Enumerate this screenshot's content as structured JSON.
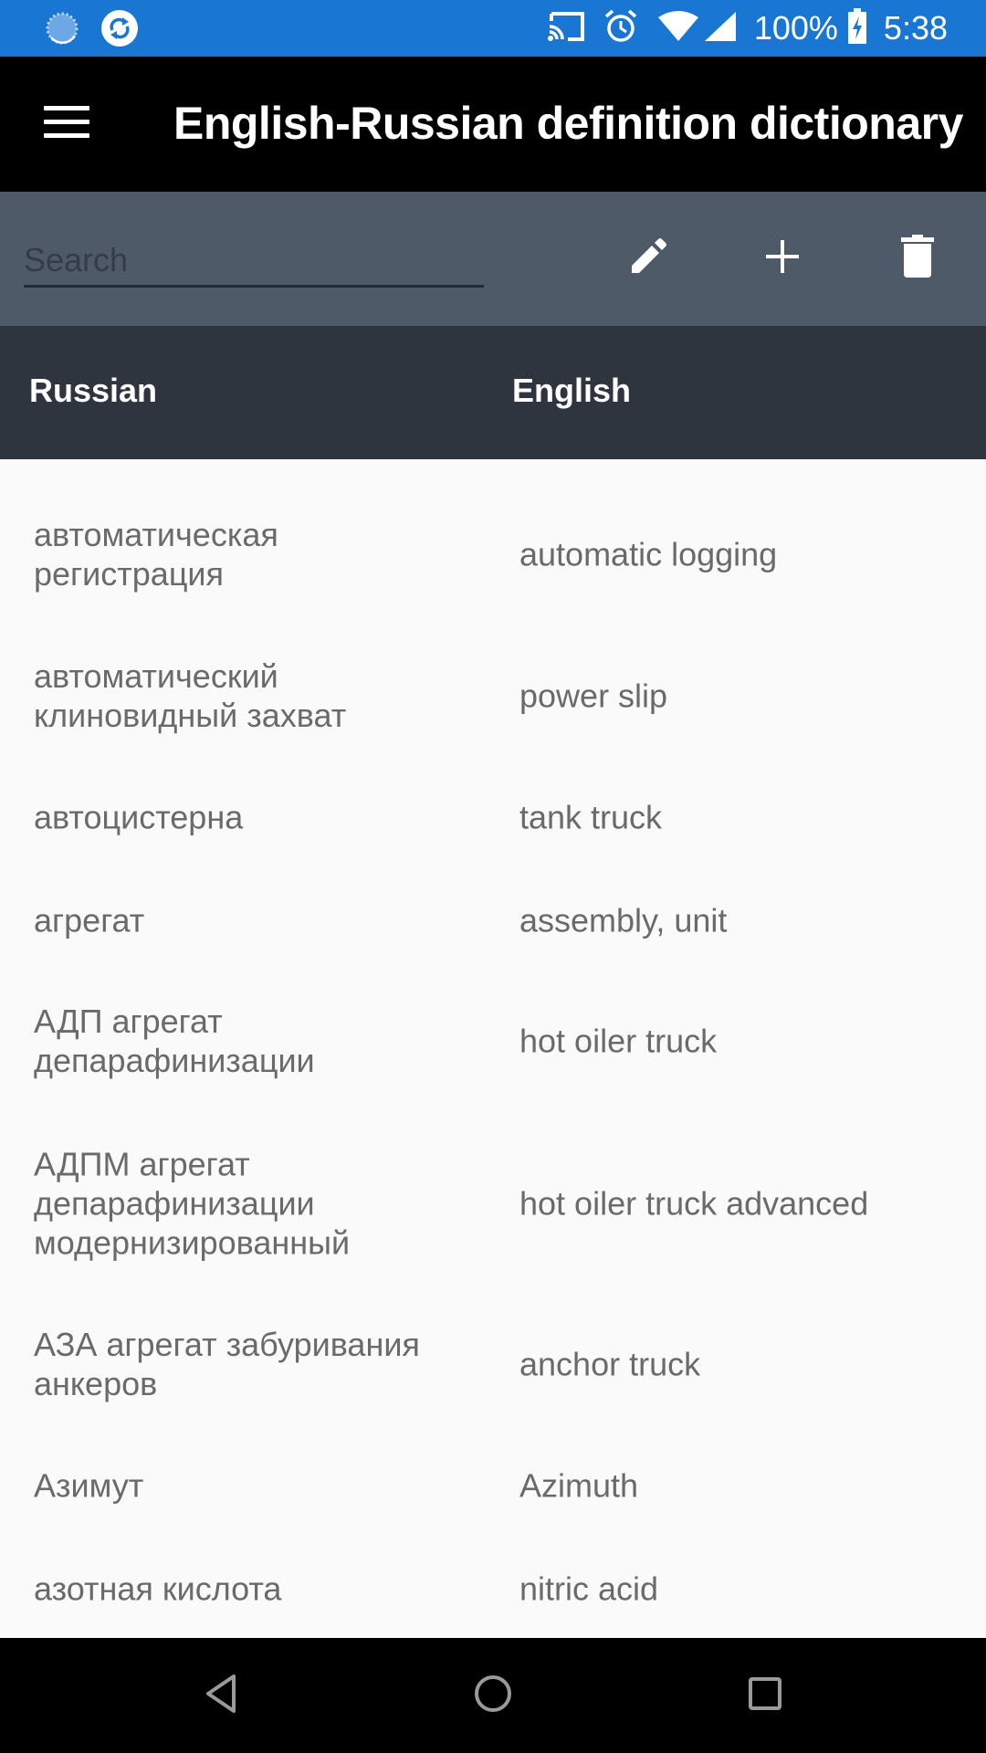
{
  "status_bar": {
    "left_icons": [
      "loading-icon",
      "sync-icon"
    ],
    "right_icons": [
      "cast-icon",
      "alarm-icon",
      "wifi-icon",
      "signal-icon"
    ],
    "battery_percent": "100%",
    "battery_icon": "battery-charging-icon",
    "time": "5:38",
    "color": "#1976d2"
  },
  "app_bar": {
    "menu_icon": "hamburger-menu-icon",
    "title": "English-Russian definition dictionary"
  },
  "toolbar": {
    "search": {
      "value": "",
      "placeholder": "Search"
    },
    "actions": [
      {
        "name": "edit",
        "icon": "pencil-icon"
      },
      {
        "name": "add",
        "icon": "plus-icon"
      },
      {
        "name": "delete",
        "icon": "trash-icon"
      }
    ],
    "color": "#4f5a68"
  },
  "table": {
    "columns": [
      "Russian",
      "English"
    ],
    "header_color": "#2f353f",
    "rows": [
      {
        "russian": "автоматическая регистрация",
        "english": "automatic logging"
      },
      {
        "russian": "автоматический клиновидный захват",
        "english": "power slip"
      },
      {
        "russian": "автоцистерна",
        "english": "tank truck"
      },
      {
        "russian": "агрегат",
        "english": "assembly, unit"
      },
      {
        "russian": "АДП агрегат депарафинизации",
        "english": "hot oiler truck"
      },
      {
        "russian": "АДПМ агрегат депарафинизации модернизированный",
        "english": "hot oiler truck advanced"
      },
      {
        "russian": "АЗА агрегат забуривания анкеров",
        "english": "anchor truck"
      },
      {
        "russian": "Азимут",
        "english": "Azimuth"
      },
      {
        "russian": "азотная кислота",
        "english": "nitric acid"
      }
    ]
  },
  "nav_bar": {
    "buttons": [
      {
        "name": "back",
        "icon": "back-triangle-icon"
      },
      {
        "name": "home",
        "icon": "home-circle-icon"
      },
      {
        "name": "recents",
        "icon": "recents-square-icon"
      }
    ]
  }
}
